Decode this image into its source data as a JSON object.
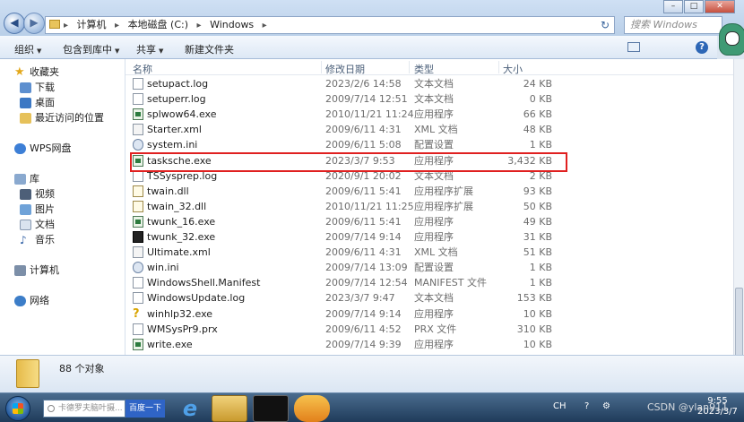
{
  "address": {
    "segments": [
      "计算机",
      "本地磁盘 (C:)",
      "Windows"
    ],
    "search_placeholder": "搜索 Windows"
  },
  "toolbar": {
    "organize": "组织",
    "include_in_library": "包含到库中",
    "share": "共享",
    "new_folder": "新建文件夹"
  },
  "nav": {
    "favorites": "收藏夹",
    "downloads": "下载",
    "desktop": "桌面",
    "recent": "最近访问的位置",
    "wps": "WPS网盘",
    "libraries": "库",
    "videos": "视频",
    "pictures": "图片",
    "documents": "文档",
    "music": "音乐",
    "computer": "计算机",
    "network": "网络"
  },
  "columns": {
    "name": "名称",
    "date": "修改日期",
    "type": "类型",
    "size": "大小"
  },
  "files": [
    {
      "name": "setupact.log",
      "date": "2023/2/6 14:58",
      "type": "文本文档",
      "size": "24 KB",
      "icon": "text-file-icon"
    },
    {
      "name": "setuperr.log",
      "date": "2009/7/14 12:51",
      "type": "文本文档",
      "size": "0 KB",
      "icon": "text-file-icon"
    },
    {
      "name": "splwow64.exe",
      "date": "2010/11/21 11:24",
      "type": "应用程序",
      "size": "66 KB",
      "icon": "exe-icon"
    },
    {
      "name": "Starter.xml",
      "date": "2009/6/11 4:31",
      "type": "XML 文档",
      "size": "48 KB",
      "icon": "xml-file-icon"
    },
    {
      "name": "system.ini",
      "date": "2009/6/11 5:08",
      "type": "配置设置",
      "size": "1 KB",
      "icon": "config-file-icon"
    },
    {
      "name": "tasksche.exe",
      "date": "2023/3/7 9:53",
      "type": "应用程序",
      "size": "3,432 KB",
      "icon": "exe-icon"
    },
    {
      "name": "TSSysprep.log",
      "date": "2020/9/1 20:02",
      "type": "文本文档",
      "size": "2 KB",
      "icon": "text-file-icon"
    },
    {
      "name": "twain.dll",
      "date": "2009/6/11 5:41",
      "type": "应用程序扩展",
      "size": "93 KB",
      "icon": "dll-file-icon"
    },
    {
      "name": "twain_32.dll",
      "date": "2010/11/21 11:25",
      "type": "应用程序扩展",
      "size": "50 KB",
      "icon": "dll-file-icon"
    },
    {
      "name": "twunk_16.exe",
      "date": "2009/6/11 5:41",
      "type": "应用程序",
      "size": "49 KB",
      "icon": "exe-icon"
    },
    {
      "name": "twunk_32.exe",
      "date": "2009/7/14 9:14",
      "type": "应用程序",
      "size": "31 KB",
      "icon": "terminal-exe-icon"
    },
    {
      "name": "Ultimate.xml",
      "date": "2009/6/11 4:31",
      "type": "XML 文档",
      "size": "51 KB",
      "icon": "xml-file-icon"
    },
    {
      "name": "win.ini",
      "date": "2009/7/14 13:09",
      "type": "配置设置",
      "size": "1 KB",
      "icon": "config-file-icon"
    },
    {
      "name": "WindowsShell.Manifest",
      "date": "2009/7/14 12:54",
      "type": "MANIFEST 文件",
      "size": "1 KB",
      "icon": "blank-file-icon"
    },
    {
      "name": "WindowsUpdate.log",
      "date": "2023/3/7 9:47",
      "type": "文本文档",
      "size": "153 KB",
      "icon": "text-file-icon"
    },
    {
      "name": "winhlp32.exe",
      "date": "2009/7/14 9:14",
      "type": "应用程序",
      "size": "10 KB",
      "icon": "help-exe-icon"
    },
    {
      "name": "WMSysPr9.prx",
      "date": "2009/6/11 4:52",
      "type": "PRX 文件",
      "size": "310 KB",
      "icon": "blank-file-icon"
    },
    {
      "name": "write.exe",
      "date": "2009/7/14 9:39",
      "type": "应用程序",
      "size": "10 KB",
      "icon": "exe-icon"
    }
  ],
  "details": {
    "item_count": "88 个对象"
  },
  "taskbar": {
    "search_placeholder": "卡德罗夫脑叶摄...",
    "search_button": "百度一下",
    "lang": "CH",
    "time": "9:55",
    "date": "2023/3/7",
    "watermark": "CSDN @ylan911"
  }
}
